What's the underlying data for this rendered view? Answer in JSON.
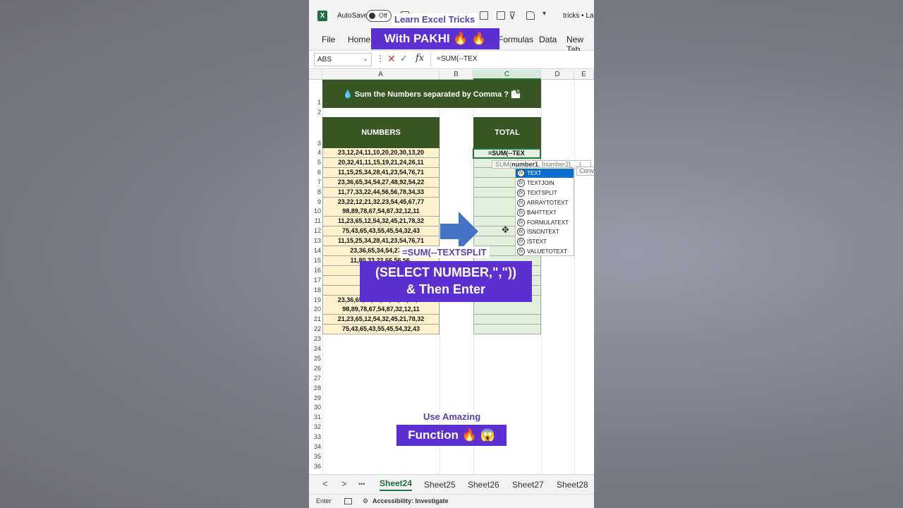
{
  "titlebar": {
    "autosave_label": "AutoSave",
    "toggle_label": "Off",
    "doc_name": "tricks • La"
  },
  "ribbon": {
    "tabs": [
      "File",
      "Home",
      "Formulas",
      "Data",
      "New Tab"
    ]
  },
  "formula_bar": {
    "name_box": "ABS",
    "formula": "=SUM(--TEX",
    "fx_label": "fx"
  },
  "columns": [
    "A",
    "B",
    "C",
    "D",
    "E"
  ],
  "rows": [
    "1",
    "2",
    "3",
    "4",
    "5",
    "6",
    "7",
    "8",
    "9",
    "10",
    "11",
    "12",
    "13",
    "14",
    "15",
    "16",
    "17",
    "18",
    "19",
    "20",
    "21",
    "22",
    "23",
    "24",
    "25",
    "26",
    "27",
    "28",
    "29",
    "30",
    "31",
    "32",
    "33",
    "34",
    "35",
    "36"
  ],
  "sheet": {
    "title": "💧 Sum the Numbers separated by Comma  ? 🏙",
    "col_a_header": "NUMBERS",
    "col_c_header": "TOTAL",
    "active_cell_text": "=SUM(--TEX",
    "numbers": [
      "23,12,24,11,10,20,20,30,13,20",
      "20,32,41,11,15,19,21,24,26,11",
      "11,15,25,34,28,41,23,54,76,71",
      "23,36,65,34,54,27,48,92,54,22",
      "11,77,33,22,44,56,56,78,34,33",
      "23,22,12,21,32,23,54,45,67,77",
      "98,89,78,67,54,87,32,12,11",
      "11,23,65,12,54,32,45,21,78,32",
      "75,43,65,43,55,45,54,32,43",
      "11,15,25,34,28,41,23,54,76,71",
      "23,36,65,34,54,27,48,",
      "11,80,33,22,66,56,56,",
      "23,12,24,",
      "20,32,41,",
      "31,15,25,",
      "23,36,65,34,54,27,48,92,54,22",
      "98,89,78,67,54,87,32,12,11",
      "21,23,65,12,54,32,45,21,78,32",
      "75,43,65,43,55,45,54,32,43"
    ]
  },
  "tooltip": {
    "prefix": "SUM(",
    "bold": "number1",
    "rest": ", [number2], ...)",
    "side_text": "Conv"
  },
  "autocomplete": [
    "TEXT",
    "TEXTJOIN",
    "TEXTSPLIT",
    "ARRAYTOTEXT",
    "BAHTTEXT",
    "FORMULATEXT",
    "ISNONTEXT",
    "ISTEXT",
    "VALUETOTEXT"
  ],
  "overlays": {
    "learn": "Learn Excel Tricks",
    "pakhi": "With PAKHI 🔥 🔥",
    "formula_hint": "=SUM(--TEXTSPLIT",
    "select_line1": "(SELECT NUMBER,\",\"))",
    "select_line2": "& Then Enter",
    "use_amazing": "Use Amazing",
    "function": "Function 🔥 😱"
  },
  "sheet_tabs": {
    "prev": "<",
    "next": ">",
    "more": "•••",
    "tabs": [
      "Sheet24",
      "Sheet25",
      "Sheet26",
      "Sheet27",
      "Sheet28"
    ]
  },
  "status": {
    "mode": "Enter",
    "accessibility": "Accessibility: Investigate"
  },
  "colors": {
    "excel_green": "#217346",
    "header_green": "#375623",
    "number_fill": "#fff2cc",
    "total_fill": "#e2efda",
    "overlay_purple": "#5b2fd1"
  }
}
